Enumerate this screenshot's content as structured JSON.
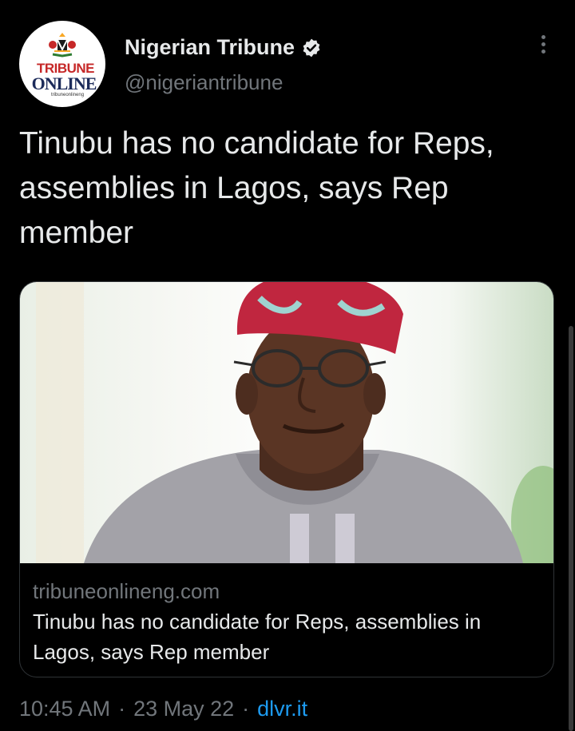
{
  "account": {
    "display_name": "Nigerian Tribune",
    "handle": "@nigeriantribune",
    "avatar_logo_top": "TRIBUNE",
    "avatar_logo_bottom": "ONLINE",
    "avatar_logo_url": "tribuneonlineng"
  },
  "tweet": {
    "text": "Tinubu has no candidate for Reps, assemblies in Lagos, says Rep member"
  },
  "card": {
    "domain": "tribuneonlineng.com",
    "title": "Tinubu has no candidate for Reps, assemblies in Lagos, says Rep member"
  },
  "meta": {
    "time": "10:45 AM",
    "date": "23 May 22",
    "separator": "·",
    "source": "dlvr.it"
  },
  "colors": {
    "background": "#000000",
    "text": "#e7e9ea",
    "muted": "#71767b",
    "link": "#1d9bf0",
    "verified": "#e7e9ea"
  },
  "icons": {
    "verified": "verified-badge-icon",
    "more": "more-options-icon"
  }
}
